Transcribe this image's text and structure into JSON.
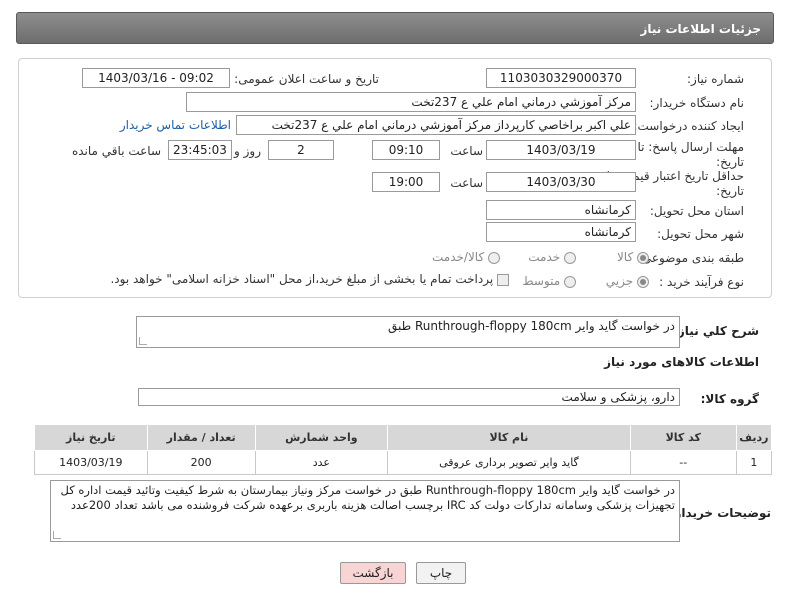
{
  "header": {
    "title": "جزئیات اطلاعات نیاز"
  },
  "fields": {
    "need_number_label": "شماره نیاز:",
    "need_number": "1103030329000370",
    "announce_label": "تاریخ و ساعت اعلان عمومی:",
    "announce_value": "1403/03/16 - 09:02",
    "buyer_org_label": "نام دستگاه خریدار:",
    "buyer_org": "مرکز آموزشي درماني امام علي ع 237تخت",
    "creator_label": "ایجاد کننده درخواست:",
    "creator": "علي اكبر براخاصي كارپرداز  مرکز آموزشي درماني امام علي ع 237تخت",
    "contact_link": "اطلاعات تماس خریدار",
    "deadline_label": "مهلت ارسال پاسخ: تا",
    "deadline_label2": "تاریخ:",
    "deadline_date": "1403/03/19",
    "time_label": "ساعت",
    "deadline_time": "09:10",
    "days_value": "2",
    "days_label": "روز و",
    "remaining_time": "23:45:03",
    "remaining_label": "ساعت باقي مانده",
    "validity_label": "حداقل تاریخ اعتبار قیمت: تا",
    "validity_label2": "تاریخ:",
    "validity_date": "1403/03/30",
    "validity_time": "19:00",
    "province_label": "استان محل تحویل:",
    "province": "کرمانشاه",
    "city_label": "شهر محل تحویل:",
    "city": "کرمانشاه",
    "category_label": "طبقه بندی موضوعی:",
    "category_options": [
      "کالا",
      "خدمت",
      "کالا/خدمت"
    ],
    "process_label": "نوع فرآیند خرید :",
    "process_options": [
      "جزیي",
      "متوسط"
    ],
    "payment_note": "پرداخت تمام یا بخشی از مبلغ خرید،از محل \"اسناد خزانه اسلامی\" خواهد بود."
  },
  "description": {
    "label": "شرح کلي نياز:",
    "text": "در خواست گاید وایر Runthrough-floppy 180cm طبق"
  },
  "goods": {
    "section_title": "اطلاعات کالاهای مورد نیاز",
    "group_label": "گروه کالا:",
    "group_value": "دارو، پزشکی و سلامت",
    "columns": [
      "ردیف",
      "کد کالا",
      "نام کالا",
      "واحد شمارش",
      "تعداد / مقدار",
      "تاریخ نیاز"
    ],
    "rows": [
      [
        "1",
        "--",
        "گاید وایر تصویر برداری عروقی",
        "عدد",
        "200",
        "1403/03/19"
      ]
    ]
  },
  "buyer_notes": {
    "label": "توضیحات خریدار:",
    "text": "در خواست گاید وایر Runthrough-floppy 180cm طبق در خواست مرکز ونیاز بیمارستان به شرط کیفیت وتائید قیمت اداره کل تجهیزات پزشکی وسامانه تدارکات دولت کد IRC برچسب اصالت  هزینه باربری برعهده شرکت فروشنده می باشد تعداد 200عدد"
  },
  "buttons": {
    "print": "چاپ",
    "back": "بازگشت"
  },
  "colors": {
    "back_button": "#f9d4d4",
    "print_button": "#f2f2f2",
    "link": "#1f5ea8"
  }
}
